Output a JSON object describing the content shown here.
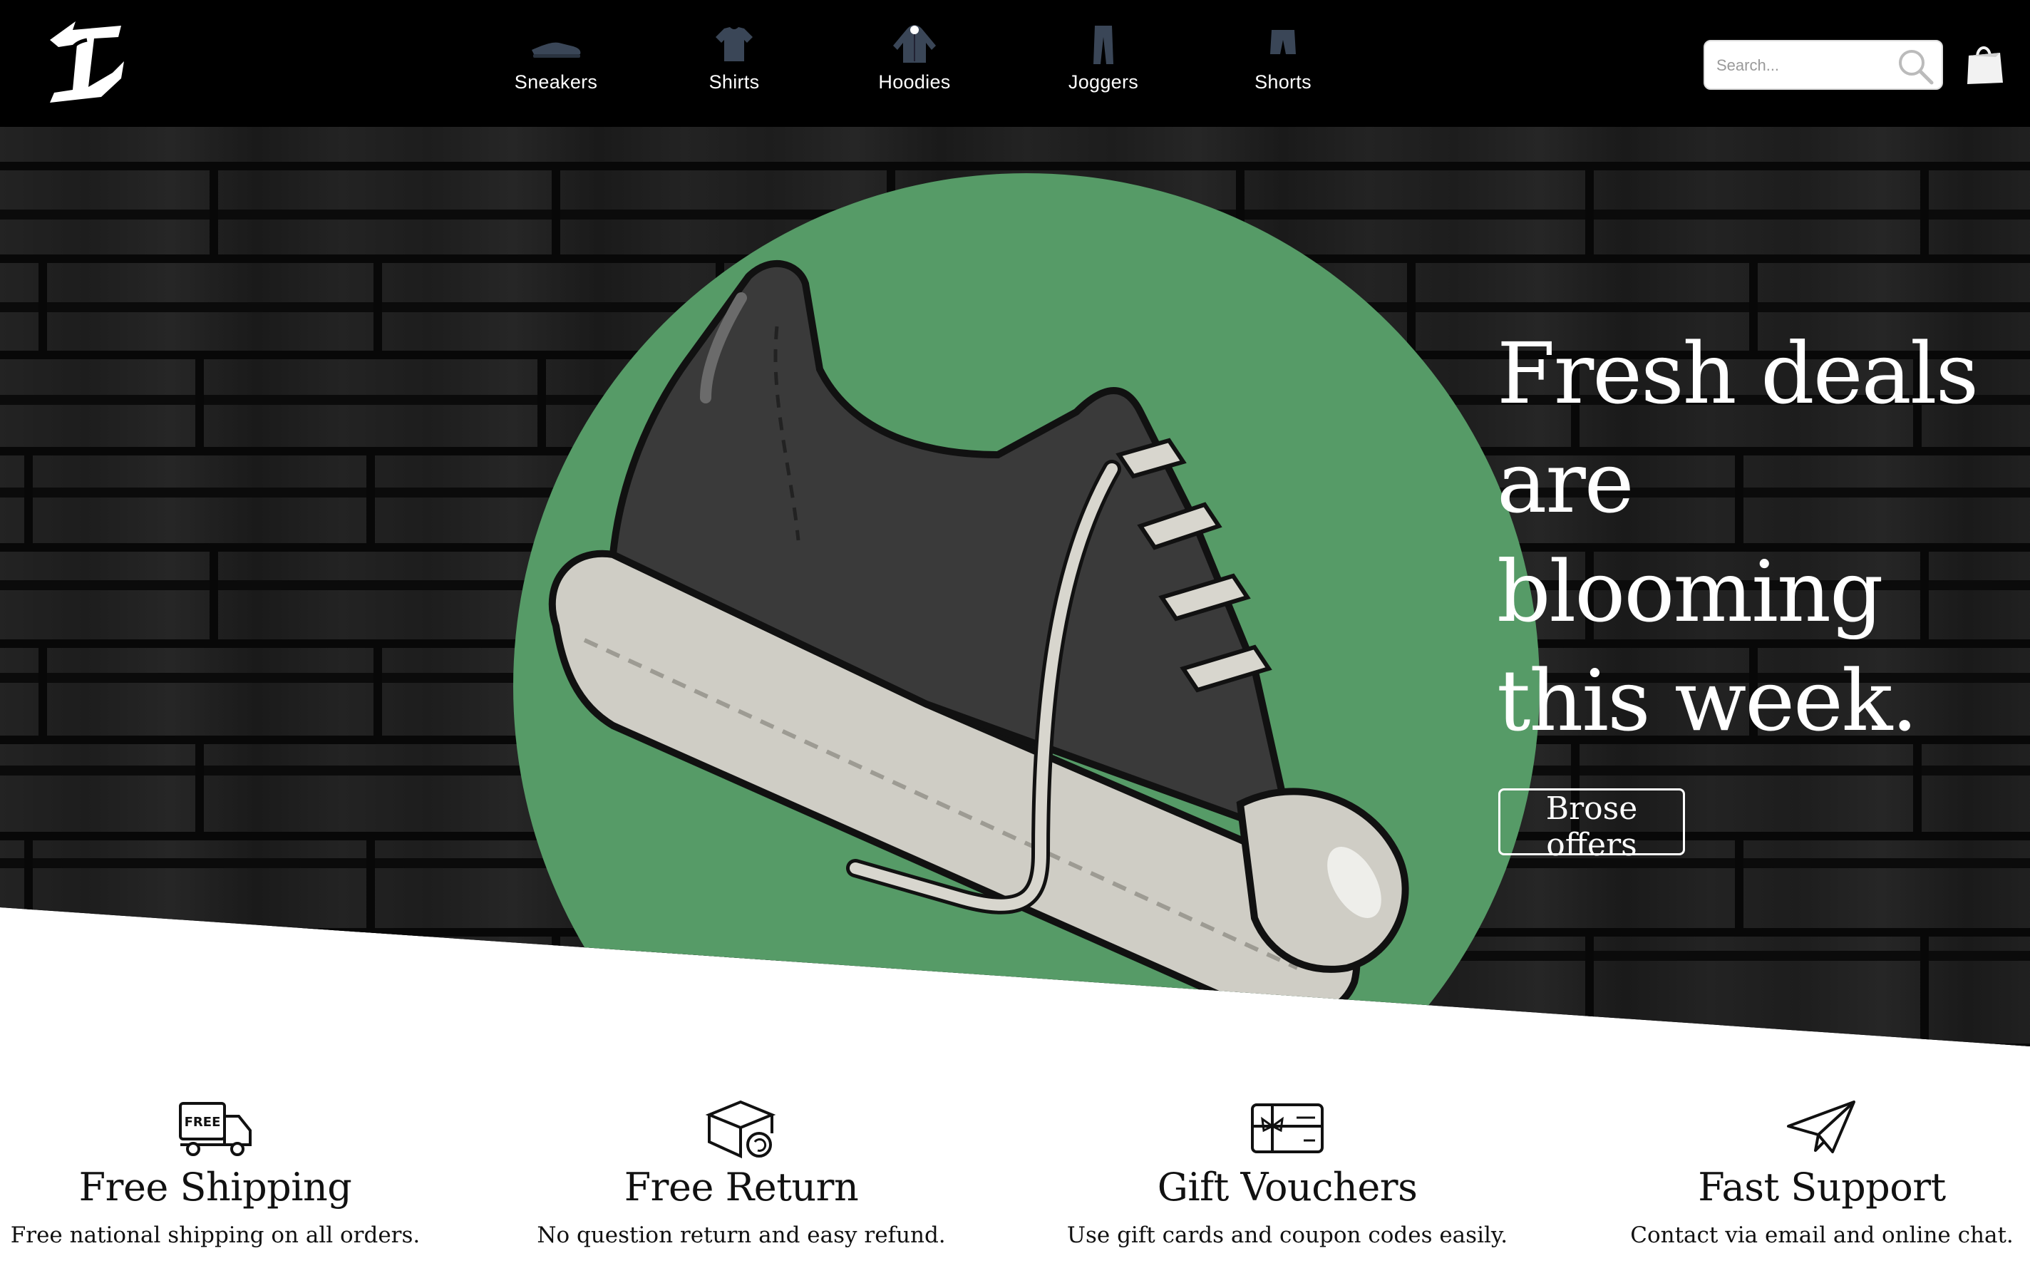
{
  "brand": {
    "logo_icon": "stylized-letters-logo"
  },
  "nav": {
    "items": [
      {
        "label": "Sneakers",
        "icon": "sneaker-icon"
      },
      {
        "label": "Shirts",
        "icon": "shirt-icon"
      },
      {
        "label": "Hoodies",
        "icon": "hoodie-icon"
      },
      {
        "label": "Joggers",
        "icon": "joggers-icon"
      },
      {
        "label": "Shorts",
        "icon": "shorts-icon"
      }
    ]
  },
  "search": {
    "placeholder": "Search...",
    "icon": "search-icon"
  },
  "cart": {
    "icon": "shopping-bag-icon"
  },
  "hero": {
    "headline_line1": "Fresh deals",
    "headline_line2": "are blooming",
    "headline_line3": "this week.",
    "cta_label": "Brose offers",
    "accent_color": "#569b67"
  },
  "features": [
    {
      "title": "Free Shipping",
      "description": "Free national shipping on all orders.",
      "icon": "free-delivery-truck-icon",
      "icon_text": "FREE"
    },
    {
      "title": "Free Return",
      "description": "No question return and easy refund.",
      "icon": "return-box-icon"
    },
    {
      "title": "Gift Vouchers",
      "description": "Use gift cards and coupon codes easily.",
      "icon": "gift-card-icon"
    },
    {
      "title": "Fast Support",
      "description": "Contact via email and online chat.",
      "icon": "paper-plane-icon"
    }
  ]
}
